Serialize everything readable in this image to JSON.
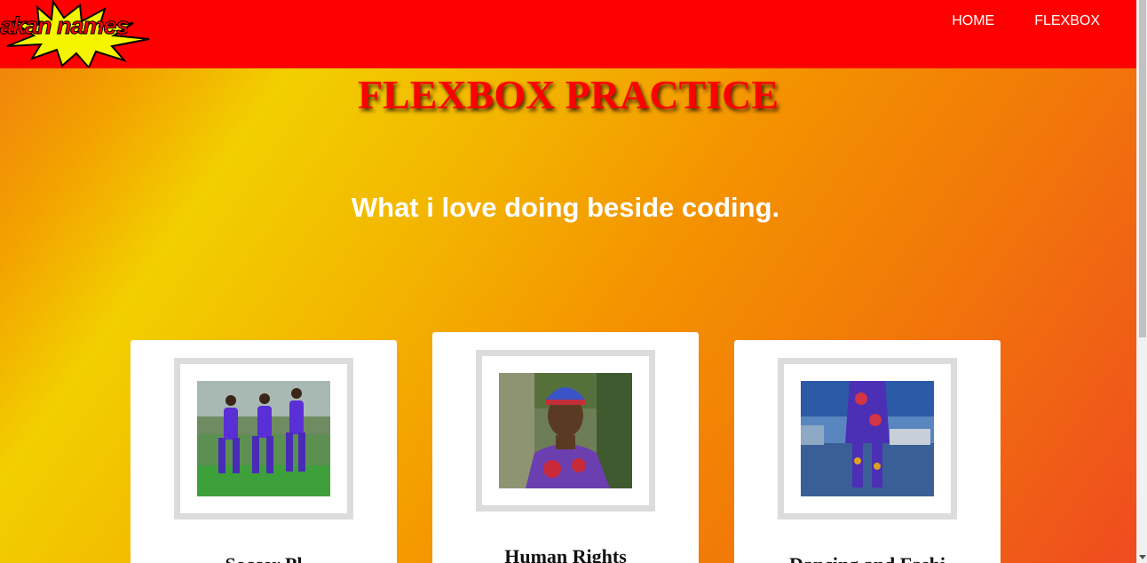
{
  "nav": {
    "logo_text": "akan names",
    "links": [
      {
        "label": "HOME"
      },
      {
        "label": "FLEXBOX"
      }
    ]
  },
  "hero": {
    "title": "FLEXBOX PRACTICE",
    "subtitle": "What i love doing beside coding."
  },
  "cards": [
    {
      "title": "Soccer Pl",
      "photo": "soccer-players-photo"
    },
    {
      "title": "Human Rights",
      "photo": "human-rights-portrait-photo"
    },
    {
      "title": "Dancing and Fashi",
      "photo": "fashion-dancer-photo"
    }
  ],
  "colors": {
    "navbar": "#ff0000",
    "title": "#ff0000",
    "subtitle": "#ffffff",
    "card_bg": "#ffffff",
    "frame": "#dcdcdc"
  }
}
